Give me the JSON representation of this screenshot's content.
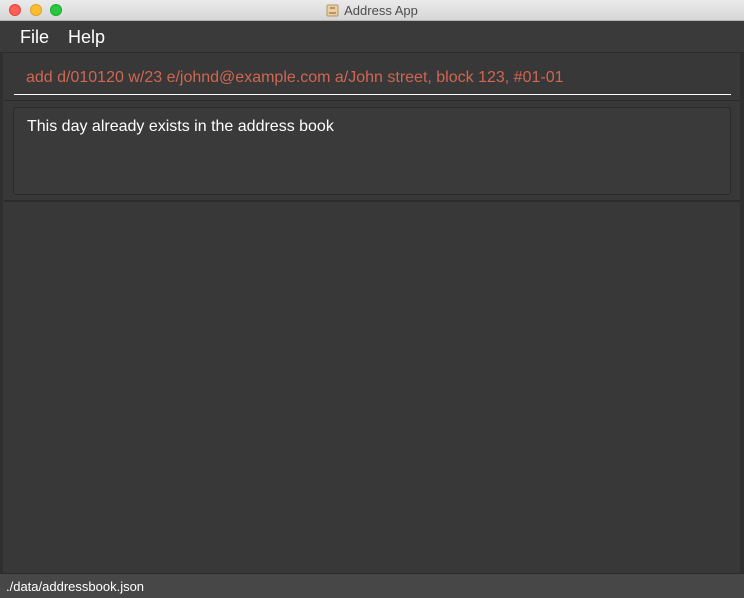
{
  "window": {
    "title": "Address App",
    "icon": "app-folder-icon"
  },
  "menu": {
    "items": [
      {
        "label": "File"
      },
      {
        "label": "Help"
      }
    ]
  },
  "command_box": {
    "value": "add d/010120 w/23 e/johnd@example.com a/John street, block 123, #01-01",
    "text_color": "#d06651"
  },
  "result_display": {
    "message": "This day already exists in the address book"
  },
  "status_bar": {
    "save_location": "./data/addressbook.json"
  },
  "colors": {
    "background": "#383838",
    "error_text": "#d06651"
  }
}
